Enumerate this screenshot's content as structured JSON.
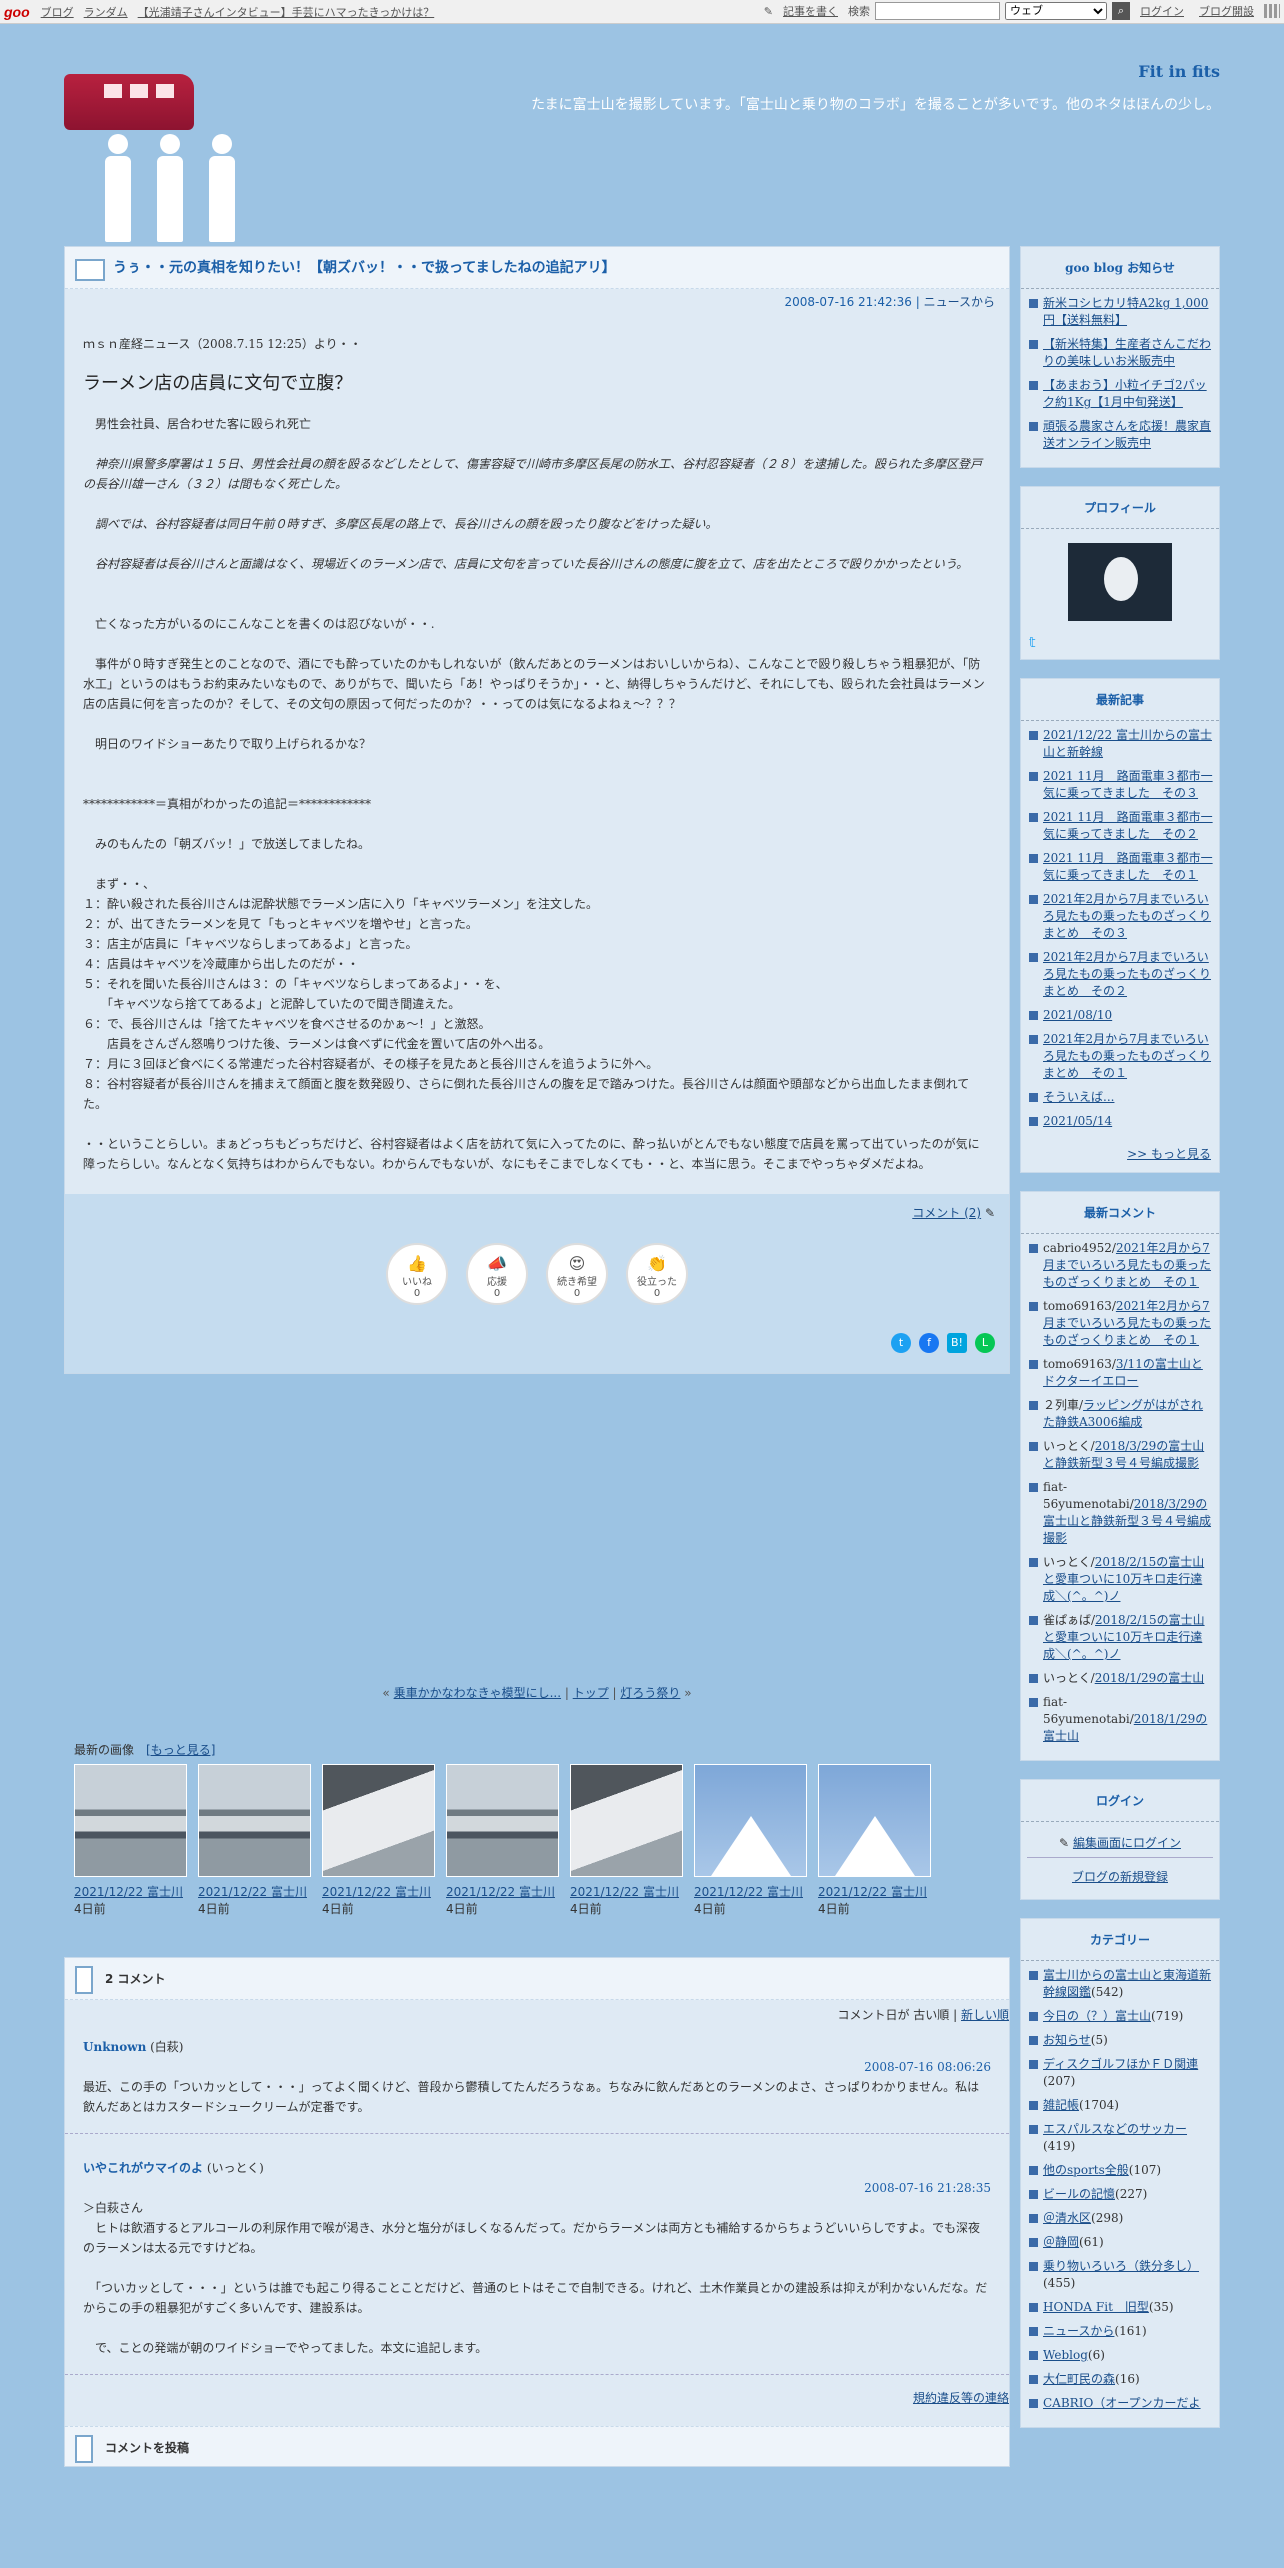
{
  "topbar": {
    "logo": "goo",
    "links": [
      "ブログ",
      "ランダム",
      "【光浦靖子さんインタビュー】手芸にハマったきっかけは？"
    ],
    "write": "記事を書く",
    "search_label": "検索",
    "search_value": "",
    "select_value": "ウェブ",
    "login": "ログイン",
    "open_blog": "ブログ開設"
  },
  "header": {
    "blog_title": "Fit in fits",
    "description": "たまに富士山を撮影しています。「富士山と乗り物のコラボ」を撮ることが多いです。他のネタはほんの少し。"
  },
  "entry": {
    "title": "うぅ・・元の真相を知りたい！【朝ズバッ！・・で扱ってましたねの追記アリ】",
    "date": "2008-07-16 21:42:36",
    "sep": " | ",
    "category": "ニュースから",
    "source": "ｍｓｎ産経ニュース（2008.7.15 12:25）より・・",
    "headline": "ラーメン店の店員に文句で立腹？",
    "p1": "　男性会社員、居合わせた客に殴られ死亡",
    "p2": "　神奈川県警多摩署は１５日、男性会社員の顔を殴るなどしたとして、傷害容疑で川崎市多摩区長尾の防水工、谷村忍容疑者（２８）を逮捕した。殴られた多摩区登戸の長谷川雄一さん（３２）は間もなく死亡した。",
    "p3": "　調べでは、谷村容疑者は同日午前０時すぎ、多摩区長尾の路上で、長谷川さんの顔を殴ったり腹などをけった疑い。",
    "p4": "　谷村容疑者は長谷川さんと面識はなく、現場近くのラーメン店で、店員に文句を言っていた長谷川さんの態度に腹を立て、店を出たところで殴りかかったという。",
    "p5": "　亡くなった方がいるのにこんなことを書くのは忍びないが・・.",
    "p6": "　事件が０時すぎ発生とのことなので、酒にでも酔っていたのかもしれないが（飲んだあとのラーメンはおいしいからね）、こんなことで殴り殺しちゃう粗暴犯が、「防水工」というのはもうお約束みたいなもので、ありがちで、聞いたら「あ！やっぱりそうか」・・と、納得しちゃうんだけど、それにしても、殴られた会社員はラーメン店の店員に何を言ったのか？そして、その文句の原因って何だったのか？・・ってのは気になるよねぇ～？？？",
    "p7": "　明日のワイドショーあたりで取り上げられるかな？",
    "p8": "************＝真相がわかったの追記＝************",
    "p9": "　みのもんたの「朝ズバッ！」で放送してましたね。",
    "list": [
      "　まず・・、",
      "１：酔い殺された長谷川さんは泥酔状態でラーメン店に入り「キャベツラーメン」を注文した。",
      "２：が、出てきたラーメンを見て「もっとキャベツを増やせ」と言った。",
      "３：店主が店員に「キャベツならしまってあるよ」と言った。",
      "４：店員はキャベツを冷蔵庫から出したのだが・・",
      "５：それを聞いた長谷川さんは３：の「キャベツならしまってあるよ」・・を、",
      "　　「キャベツなら捨ててあるよ」と泥酔していたので聞き間違えた。",
      "６：で、長谷川さんは「捨てたキャベツを食べさせるのかぁ～！」と激怒。",
      "　　店員をさんざん怒鳴りつけた後、ラーメンは食べずに代金を置いて店の外へ出る。",
      "７：月に３回ほど食べにくる常連だった谷村容疑者が、その様子を見たあと長谷川さんを追うように外へ。",
      "８：谷村容疑者が長谷川さんを捕まえて顔面と腹を数発殴り、さらに倒れた長谷川さんの腹を足で踏みつけた。長谷川さんは顔面や頭部などから出血したまま倒れてた。"
    ],
    "p10": "・・ということらしい。まぁどっちもどっちだけど、谷村容疑者はよく店を訪れて気に入ってたのに、酔っ払いがとんでもない態度で店員を罵って出ていったのが気に障ったらしい。なんとなく気持ちはわからんでもない。わからんでもないが、なにもそこまでしなくても・・と、本当に思う。そこまでやっちゃダメだよね。",
    "comment_link": "コメント (2)",
    "reactions": [
      {
        "label": "いいね",
        "count": "0",
        "icon": "thumbs-up-icon",
        "glyph": "👍"
      },
      {
        "label": "応援",
        "count": "0",
        "icon": "megaphone-icon",
        "glyph": "📣"
      },
      {
        "label": "続き希望",
        "count": "0",
        "icon": "heart-eyes-icon",
        "glyph": "😍"
      },
      {
        "label": "役立った",
        "count": "0",
        "icon": "clap-icon",
        "glyph": "👏"
      }
    ]
  },
  "pager": {
    "prev": "乗車かかなわなきゃ模型にし...",
    "top": "トップ",
    "next": "灯ろう祭り"
  },
  "latest_images": {
    "label": "最新の画像",
    "more": "[もっと見る]",
    "items": [
      {
        "title": "2021/12/22 富士川",
        "ago": "4日前",
        "kind": "bridge"
      },
      {
        "title": "2021/12/22 富士川",
        "ago": "4日前",
        "kind": "bridge"
      },
      {
        "title": "2021/12/22 富士川",
        "ago": "4日前",
        "kind": "train2"
      },
      {
        "title": "2021/12/22 富士川",
        "ago": "4日前",
        "kind": "bridge"
      },
      {
        "title": "2021/12/22 富士川",
        "ago": "4日前",
        "kind": "train2"
      },
      {
        "title": "2021/12/22 富士川",
        "ago": "4日前",
        "kind": "fuji"
      },
      {
        "title": "2021/12/22 富士川",
        "ago": "4日前",
        "kind": "fuji"
      }
    ]
  },
  "comments": {
    "heading": "2 コメント",
    "sort_label": "コメント日が",
    "sort_old": "古い順",
    "sort_new": "新しい順",
    "items": [
      {
        "name": "Unknown",
        "suffix": " (白萩)",
        "date": "2008-07-16 08:06:26",
        "text": "最近、この手の「ついカッとして・・・」ってよく聞くけど、普段から鬱積してたんだろうなぁ。ちなみに飲んだあとのラーメンのよさ、さっぱりわかりません。私は飲んだあとはカスタードシュークリームが定番です。"
      },
      {
        "name": "いやこれがウマイのよ",
        "suffix": " (いっとく)",
        "date": "2008-07-16 21:28:35",
        "text1": "＞白萩さん",
        "text2": "　ヒトは飲酒するとアルコールの利尿作用で喉が渇き、水分と塩分がほしくなるんだって。だからラーメンは両方とも補給するからちょうどいいらしですよ。でも深夜のラーメンは太る元ですけどね。",
        "text3": "　「ついカッとして・・・」というは誰でも起こり得ることことだけど、普通のヒトはそこで自制できる。けれど、土木作業員とかの建設系は抑えが利かないんだな。だからこの手の粗暴犯がすごく多いんです、建設系は。",
        "text4": "　で、ことの発端が朝のワイドショーでやってました。本文に追記します。"
      }
    ],
    "report": "規約違反等の連絡",
    "post_heading": "コメントを投稿"
  },
  "sidebar": {
    "notice": {
      "title": "goo blog お知らせ",
      "items": [
        "新米コシヒカリ特A2kg 1,000円【送料無料】",
        "【新米特集】生産者さんこだわりの美味しいお米販売中",
        "【あまおう】小粒イチゴ2パック約1Kg【1月中旬発送】",
        "頑張る農家さんを応援！農家直送オンライン販売中"
      ]
    },
    "profile": {
      "title": "プロフィール",
      "twitter": "𝕥"
    },
    "recent": {
      "title": "最新記事",
      "items": [
        "2021/12/22 富士川からの富士山と新幹線",
        "2021 11月　路面電車３都市一気に乗ってきました　その３",
        "2021 11月　路面電車３都市一気に乗ってきました　その２",
        "2021 11月　路面電車３都市一気に乗ってきました　その１",
        "2021年2月から7月までいろいろ見たもの乗ったものざっくりまとめ　その３",
        "2021年2月から7月までいろいろ見たもの乗ったものざっくりまとめ　その２",
        "2021/08/10",
        "2021年2月から7月までいろいろ見たもの乗ったものざっくりまとめ　その１",
        "そういえば...",
        "2021/05/14"
      ],
      "more": ">> もっと見る"
    },
    "recent_comments": {
      "title": "最新コメント",
      "items": [
        {
          "who": "cabrio4952/",
          "link": "2021年2月から7月までいろいろ見たもの乗ったものざっくりまとめ　その１"
        },
        {
          "who": "tomo69163/",
          "link": "2021年2月から7月までいろいろ見たもの乗ったものざっくりまとめ　その１"
        },
        {
          "who": "tomo69163/",
          "link": "3/11の富士山とドクターイエロー"
        },
        {
          "who": "２列車/",
          "link": "ラッピングがはがされた静鉄A3006編成"
        },
        {
          "who": "いっとく/",
          "link": "2018/3/29の富士山と静鉄新型３号４号編成撮影"
        },
        {
          "who": "fiat-56yumenotabi/",
          "link": "2018/3/29の富士山と静鉄新型３号４号編成撮影"
        },
        {
          "who": "いっとく/",
          "link": "2018/2/15の富士山と愛車ついに10万キロ走行達成＼(^。^)ノ"
        },
        {
          "who": "雀ぱぁば/",
          "link": "2018/2/15の富士山と愛車ついに10万キロ走行達成＼(^。^)ノ"
        },
        {
          "who": "いっとく/",
          "link": "2018/1/29の富士山"
        },
        {
          "who": "fiat-56yumenotabi/",
          "link": "2018/1/29の富士山"
        }
      ]
    },
    "login": {
      "title": "ログイン",
      "edit": "編集画面にログイン",
      "register": "ブログの新規登録"
    },
    "categories": {
      "title": "カテゴリー",
      "items": [
        {
          "name": "富士川からの富士山と東海道新幹線図鑑",
          "count": "(542)"
        },
        {
          "name": "今日の（？）富士山",
          "count": "(719)"
        },
        {
          "name": "お知らせ",
          "count": "(5)"
        },
        {
          "name": "ディスクゴルフほかＦＤ関連",
          "count": "(207)"
        },
        {
          "name": "雑記帳",
          "count": "(1704)"
        },
        {
          "name": "エスパルスなどのサッカー",
          "count": "(419)"
        },
        {
          "name": "他のsports全般",
          "count": "(107)"
        },
        {
          "name": "ビールの記憶",
          "count": "(227)"
        },
        {
          "name": "＠清水区",
          "count": "(298)"
        },
        {
          "name": "＠静岡",
          "count": "(61)"
        },
        {
          "name": "乗り物いろいろ（鉄分多し）",
          "count": "(455)"
        },
        {
          "name": "HONDA Fit　旧型",
          "count": "(35)"
        },
        {
          "name": "ニュースから",
          "count": "(161)"
        },
        {
          "name": "Weblog",
          "count": "(6)"
        },
        {
          "name": "大仁町民の森",
          "count": "(16)"
        },
        {
          "name": "CABRIO（オープンカーだよ",
          "count": ""
        }
      ]
    }
  },
  "colors": {
    "accent": "#1b5fa8",
    "page_bg": "#9cc3e3",
    "train": "#b8213f"
  }
}
